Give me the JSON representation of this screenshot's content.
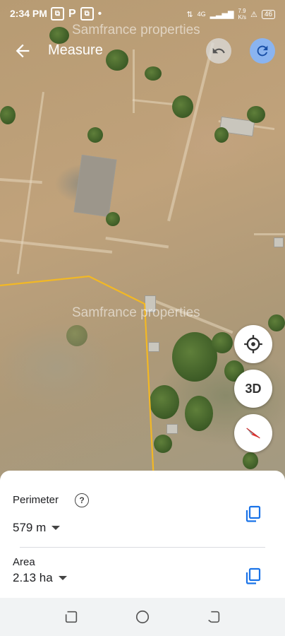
{
  "status_bar": {
    "time": "2:34 PM",
    "notification_badges": [
      "⧉",
      "P",
      "⧉"
    ],
    "dot": "•",
    "network": "4G",
    "speed": "7.9\nK/s",
    "battery": "46"
  },
  "watermarks": [
    "Samfrance properties",
    "Samfrance properties"
  ],
  "header": {
    "title": "Measure",
    "back_icon": "arrow-left-icon",
    "undo_icon": "undo-icon",
    "redo_icon": "redo-icon"
  },
  "map_controls": {
    "locate_icon": "my-location-icon",
    "three_d_label": "3D",
    "compass_icon": "compass-icon"
  },
  "measurement_line_color": "#f2b825",
  "sheet": {
    "perimeter_label": "Perimeter",
    "perimeter_value": "579 m",
    "area_label": "Area",
    "area_value": "2.13 ha",
    "copy_icon_color": "#1a73e8"
  },
  "nav_bar": {
    "recents_icon": "recents-icon",
    "home_icon": "home-circle-icon",
    "back_icon": "back-icon"
  }
}
